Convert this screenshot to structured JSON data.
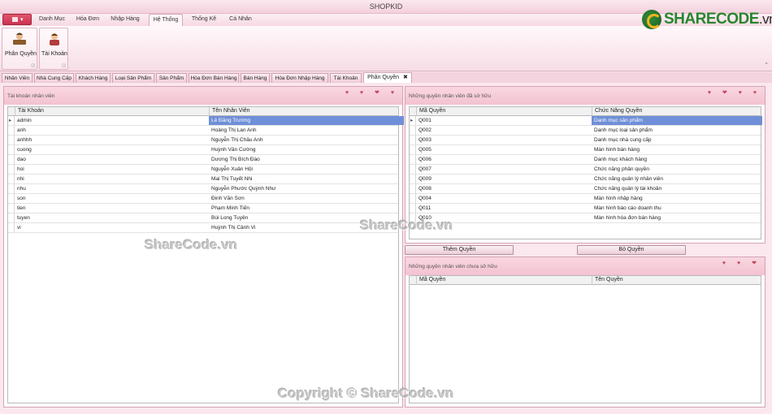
{
  "window": {
    "title": "SHOPKID"
  },
  "menu": {
    "tabs": [
      "Danh Mục",
      "Hóa Đơn",
      "Nhập Hàng",
      "Hệ Thống",
      "Thống Kê",
      "Cá Nhân"
    ],
    "active": "Hệ Thống"
  },
  "ribbon": {
    "buttons": [
      {
        "label": "Phân Quyền",
        "icon": "user-permission-icon"
      },
      {
        "label": "Tài Khoản",
        "icon": "user-account-icon"
      }
    ]
  },
  "logo": {
    "brand": "SHARECODE",
    "suffix": ".vn"
  },
  "doc_tabs": [
    "Nhân Viên",
    "Nhà Cung Cấp",
    "Khách Hàng",
    "Loại Sản Phẩm",
    "Sản Phẩm",
    "Hóa Đơn Bán Hàng",
    "Bán Hàng",
    "Hóa Đơn Nhập Hàng",
    "Tài Khoản",
    "Phân Quyền"
  ],
  "active_doc_tab": "Phân Quyền",
  "left_panel": {
    "caption": "Tài khoản nhân viên",
    "columns": [
      "Tài Khoản",
      "Tên Nhân Viên"
    ],
    "rows": [
      [
        "admin",
        "Lê Đăng Trường"
      ],
      [
        "anh",
        "Hoàng Thị Lan Anh"
      ],
      [
        "anhhh",
        "Nguyễn Thị Châu Anh"
      ],
      [
        "cuong",
        "Huỳnh Văn Cường"
      ],
      [
        "dao",
        "Dương Thị Bích Đào"
      ],
      [
        "hoi",
        "Nguyễn Xuân Hội"
      ],
      [
        "nhi",
        "Mai Thị Tuyết Nhi"
      ],
      [
        "nhu",
        "Nguyễn Phước Quỳnh Như"
      ],
      [
        "son",
        "Đinh Văn Sơn"
      ],
      [
        "tien",
        "Phạm Minh Tiến"
      ],
      [
        "tuyen",
        "Bùi Long Tuyên"
      ],
      [
        "vi",
        "Huỳnh Thị Cảnh Vi"
      ]
    ]
  },
  "owned_panel": {
    "caption": "Những quyền nhân viên đã sở hữu",
    "columns": [
      "Mã Quyền",
      "Chức Năng Quyền"
    ],
    "rows": [
      [
        "Q001",
        "Danh mục sản phẩm"
      ],
      [
        "Q002",
        "Danh mục loại sản phẩm"
      ],
      [
        "Q003",
        "Danh mục nhà cung cấp"
      ],
      [
        "Q005",
        "Màn hình bán hàng"
      ],
      [
        "Q006",
        "Danh mục khách hàng"
      ],
      [
        "Q007",
        "Chức năng phân quyền"
      ],
      [
        "Q009",
        "Chức năng quản lý nhân viên"
      ],
      [
        "Q008",
        "Chức năng quản lý tài khoản"
      ],
      [
        "Q004",
        "Màn hình nhập hàng"
      ],
      [
        "Q011",
        "Màn hình báo cáo doanh thu"
      ],
      [
        "Q010",
        "Màn hình hóa đơn bán hàng"
      ]
    ]
  },
  "actions": {
    "add": "Thêm Quyền",
    "remove": "Bỏ Quyền"
  },
  "unowned_panel": {
    "caption": "Những quyền nhân viên chưa sở hữu",
    "columns": [
      "Mã Quyền",
      "Tên Quyền"
    ]
  },
  "watermarks": [
    "ShareCode.vn",
    "ShareCode.vn",
    "Copyright © ShareCode.vn"
  ]
}
